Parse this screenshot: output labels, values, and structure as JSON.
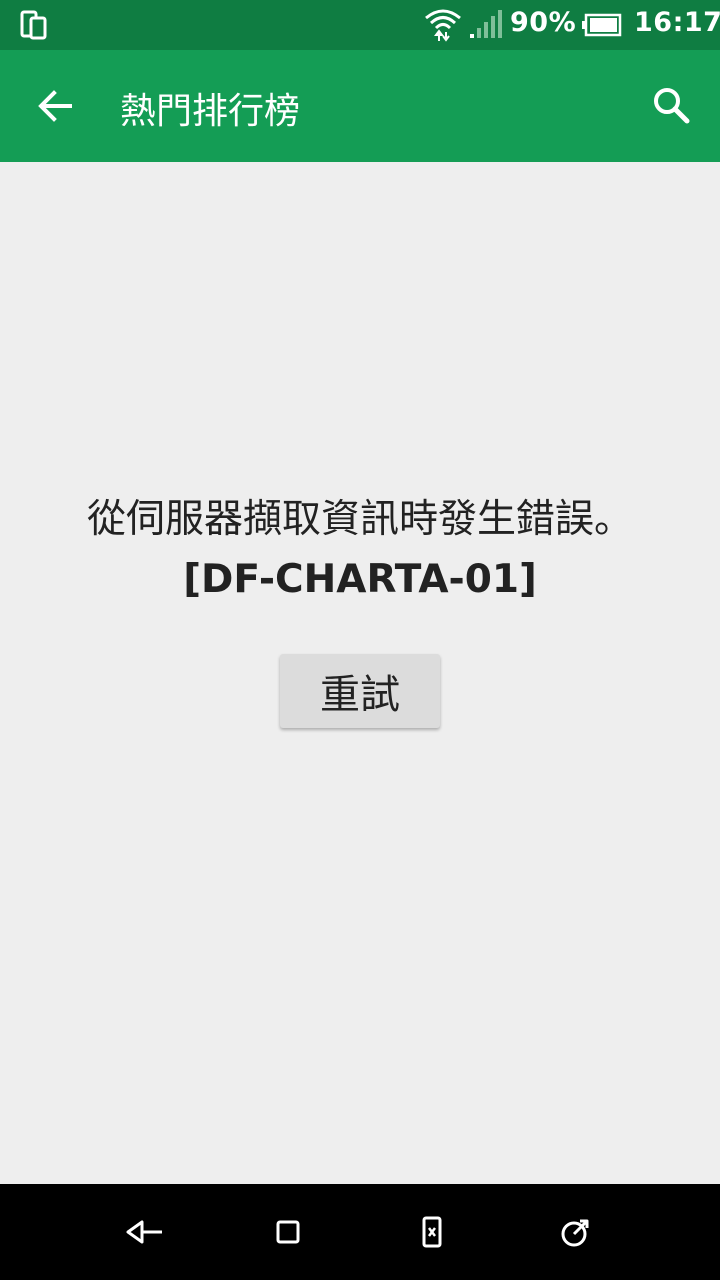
{
  "status_bar": {
    "left_icon": "phone-rotation-icon",
    "wifi_icon": "wifi-icon",
    "signal_icon": "signal-icon",
    "battery_percent": "90%",
    "battery_icon": "battery-icon",
    "time": "16:17"
  },
  "app_bar": {
    "back_icon": "arrow-back-icon",
    "title": "熱門排行榜",
    "search_icon": "search-icon",
    "background_color": "#149d55"
  },
  "content": {
    "error_message": "從伺服器擷取資訊時發生錯誤。",
    "error_code": "[DF-CHARTA-01]",
    "retry_label": "重試"
  },
  "nav_bar": {
    "back_icon": "nav-back-icon",
    "home_icon": "nav-home-icon",
    "screen_icon": "nav-screen-icon",
    "recents_icon": "nav-recents-icon"
  }
}
